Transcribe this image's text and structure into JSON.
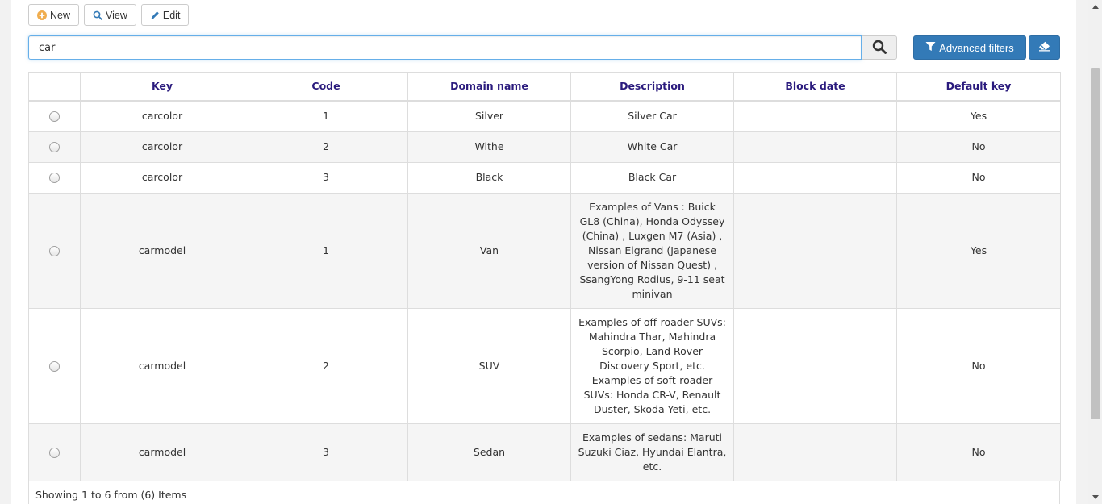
{
  "toolbar": {
    "new_label": "New",
    "view_label": "View",
    "edit_label": "Edit"
  },
  "search": {
    "value": "car",
    "advanced_filters_label": "Advanced filters"
  },
  "table": {
    "columns": [
      "",
      "Key",
      "Code",
      "Domain name",
      "Description",
      "Block date",
      "Default key"
    ],
    "rows": [
      {
        "key": "carcolor",
        "code": "1",
        "domain": "Silver",
        "description": "Silver Car",
        "block_date": "",
        "default_key": "Yes"
      },
      {
        "key": "carcolor",
        "code": "2",
        "domain": "Withe",
        "description": "White Car",
        "block_date": "",
        "default_key": "No"
      },
      {
        "key": "carcolor",
        "code": "3",
        "domain": "Black",
        "description": "Black Car",
        "block_date": "",
        "default_key": "No"
      },
      {
        "key": "carmodel",
        "code": "1",
        "domain": "Van",
        "description": "Examples of Vans : Buick GL8 (China), Honda Odyssey (China) , Luxgen M7 (Asia) , Nissan Elgrand (Japanese version of Nissan Quest) , SsangYong Rodius, 9-11 seat minivan",
        "block_date": "",
        "default_key": "Yes"
      },
      {
        "key": "carmodel",
        "code": "2",
        "domain": "SUV",
        "description": "Examples of off-roader SUVs: Mahindra Thar, Mahindra Scorpio, Land Rover Discovery Sport, etc. Examples of soft-roader SUVs: Honda CR-V, Renault Duster, Skoda Yeti, etc.",
        "block_date": "",
        "default_key": "No"
      },
      {
        "key": "carmodel",
        "code": "3",
        "domain": "Sedan",
        "description": "Examples of sedans: Maruti Suzuki Ciaz, Hyundai Elantra, etc.",
        "block_date": "",
        "default_key": "No"
      }
    ]
  },
  "footer": {
    "text": "Showing 1 to 6 from (6) Items"
  },
  "colors": {
    "primary": "#337ab7",
    "header_text": "#2a1a7d",
    "new_icon": "#f0ad4e"
  },
  "icons": {
    "new": "plus-circle-icon",
    "view": "search-icon",
    "edit": "pencil-icon",
    "search": "search-icon",
    "filter": "filter-icon",
    "erase": "eraser-icon"
  }
}
